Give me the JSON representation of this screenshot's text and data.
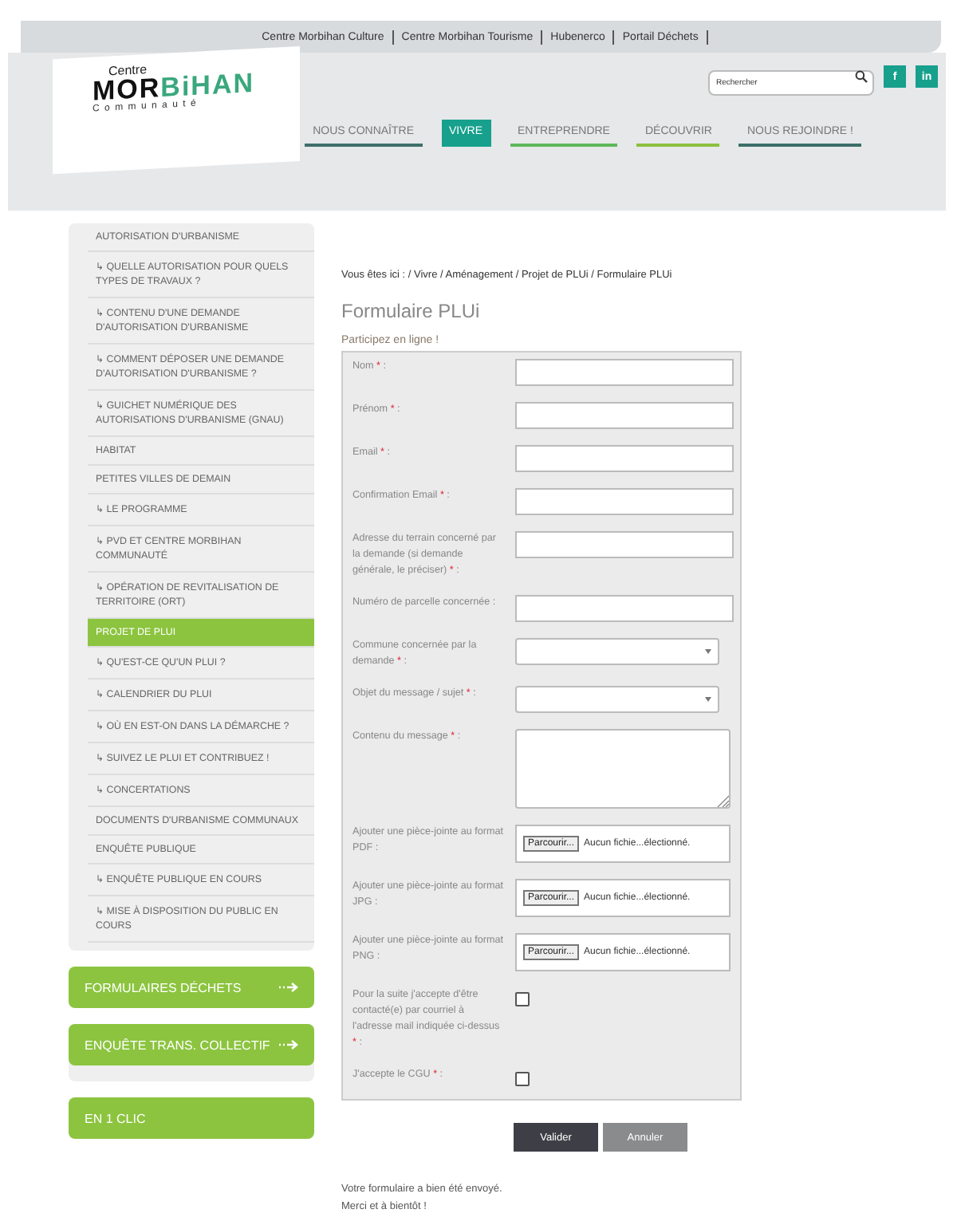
{
  "top_links": [
    "Centre Morbihan Culture",
    "Centre Morbihan Tourisme",
    "Hubenerco",
    "Portail Déchets"
  ],
  "logo": {
    "line1": "Centre",
    "word_dark": "MOR",
    "word_green": "BiHAN",
    "line3": "Communauté"
  },
  "search": {
    "placeholder": "Rechercher"
  },
  "social": [
    "f",
    "in"
  ],
  "nav": [
    {
      "label": "NOUS CONNAÎTRE",
      "selected": false,
      "color": "#3f6e6b"
    },
    {
      "label": "VIVRE",
      "selected": true,
      "color": "#17a08c"
    },
    {
      "label": "ENTREPRENDRE",
      "selected": false,
      "color": "#5db85a"
    },
    {
      "label": "DÉCOUVRIR",
      "selected": false,
      "color": "#8cbf3f"
    },
    {
      "label": "NOUS REJOINDRE !",
      "selected": false,
      "color": "#3d6e6a"
    }
  ],
  "sidebar": {
    "items": [
      {
        "label": "AUTORISATION D'URBANISME",
        "kind": "top",
        "selected": false
      },
      {
        "label": "↳ QUELLE AUTORISATION POUR QUELS TYPES DE TRAVAUX ?",
        "kind": "sub",
        "selected": false
      },
      {
        "label": "↳ CONTENU D'UNE DEMANDE D'AUTORISATION D'URBANISME",
        "kind": "sub",
        "selected": false
      },
      {
        "label": "↳ COMMENT DÉPOSER UNE DEMANDE D'AUTORISATION D'URBANISME ?",
        "kind": "sub",
        "selected": false
      },
      {
        "label": "↳ GUICHET NUMÉRIQUE DES AUTORISATIONS D'URBANISME (GNAU)",
        "kind": "sub",
        "selected": false
      },
      {
        "label": "HABITAT",
        "kind": "top",
        "selected": false
      },
      {
        "label": "PETITES VILLES DE DEMAIN",
        "kind": "top",
        "selected": false
      },
      {
        "label": "↳ LE PROGRAMME",
        "kind": "sub",
        "selected": false
      },
      {
        "label": "↳ PVD ET CENTRE MORBIHAN COMMUNAUTÉ",
        "kind": "sub",
        "selected": false
      },
      {
        "label": "↳ OPÉRATION DE REVITALISATION DE TERRITOIRE (ORT)",
        "kind": "sub",
        "selected": false
      },
      {
        "label": "PROJET DE PLUI",
        "kind": "top",
        "selected": true
      },
      {
        "label": "↳ QU'EST-CE QU'UN PLUI ?",
        "kind": "sub",
        "selected": false
      },
      {
        "label": "↳ CALENDRIER DU PLUI",
        "kind": "sub",
        "selected": false
      },
      {
        "label": "↳ OÙ EN EST-ON DANS LA DÉMARCHE ?",
        "kind": "sub",
        "selected": false
      },
      {
        "label": "↳ SUIVEZ LE PLUI ET CONTRIBUEZ !",
        "kind": "sub",
        "selected": false
      },
      {
        "label": "↳ CONCERTATIONS",
        "kind": "sub",
        "selected": false
      },
      {
        "label": "DOCUMENTS D'URBANISME COMMUNAUX",
        "kind": "top",
        "selected": false
      },
      {
        "label": "ENQUÊTE PUBLIQUE",
        "kind": "top",
        "selected": false
      },
      {
        "label": "↳ ENQUÊTE PUBLIQUE EN COURS",
        "kind": "sub",
        "selected": false
      },
      {
        "label": "↳ MISE À DISPOSITION DU PUBLIC EN COURS",
        "kind": "sub",
        "selected": false
      }
    ],
    "tiles": [
      {
        "label": "FORMULAIRES DÉCHETS"
      },
      {
        "label": "ENQUÊTE TRANS. COLLECTIF"
      },
      {
        "label": "EN 1 CLIC"
      }
    ]
  },
  "breadcrumb": "Vous êtes ici : / Vivre / Aménagement / Projet de PLUi / Formulaire PLUi",
  "title": "Formulaire PLUi",
  "subtitle": "Participez en ligne !",
  "form": {
    "fields": [
      {
        "kind": "text",
        "label": "Nom",
        "required_mark": "*",
        "label_end": ":"
      },
      {
        "kind": "text",
        "label": "Prénom",
        "required_mark": "*",
        "label_end": ":"
      },
      {
        "kind": "text",
        "label": "Email",
        "required_mark": "*",
        "label_end": ":"
      },
      {
        "kind": "text",
        "label": "Confirmation Email",
        "required_mark": "*",
        "label_end": ":"
      },
      {
        "kind": "text",
        "label": "Adresse du terrain concerné par la demande (si demande générale, le préciser)",
        "required_mark": "*",
        "label_end": ":"
      },
      {
        "kind": "text",
        "label": "Numéro de parcelle concernée :"
      },
      {
        "kind": "select",
        "label": "Commune concernée par la demande",
        "required_mark": "*",
        "label_end": ":"
      },
      {
        "kind": "select",
        "label": "Objet du message / sujet",
        "required_mark": "*",
        "label_end": ":"
      },
      {
        "kind": "textarea",
        "label": "Contenu du message",
        "required_mark": "*",
        "label_end": ":"
      },
      {
        "kind": "file",
        "label": "Ajouter une pièce-jointe au format PDF :",
        "button": "Parcourir...",
        "status": "Aucun fichie...électionné."
      },
      {
        "kind": "file",
        "label": "Ajouter une pièce-jointe au format JPG :",
        "button": "Parcourir...",
        "status": "Aucun fichie...électionné."
      },
      {
        "kind": "file",
        "label": "Ajouter une pièce-jointe au format PNG :",
        "button": "Parcourir...",
        "status": "Aucun fichie...électionné."
      },
      {
        "kind": "checkbox",
        "label": "Pour la suite j'accepte d'être contacté(e) par courriel à l'adresse mail indiquée ci-dessus",
        "required_mark": "*",
        "label_end": ":",
        "checked": false
      },
      {
        "kind": "checkbox",
        "label": "J'accepte le CGU",
        "required_mark": "*",
        "label_end": ":",
        "checked": false
      }
    ],
    "buttons": [
      {
        "label": "Valider",
        "kind": "primary"
      },
      {
        "label": "Annuler",
        "kind": "secondary"
      }
    ]
  },
  "confirmation": [
    "Votre formulaire a bien été envoyé.",
    "Merci et à bientôt !"
  ]
}
